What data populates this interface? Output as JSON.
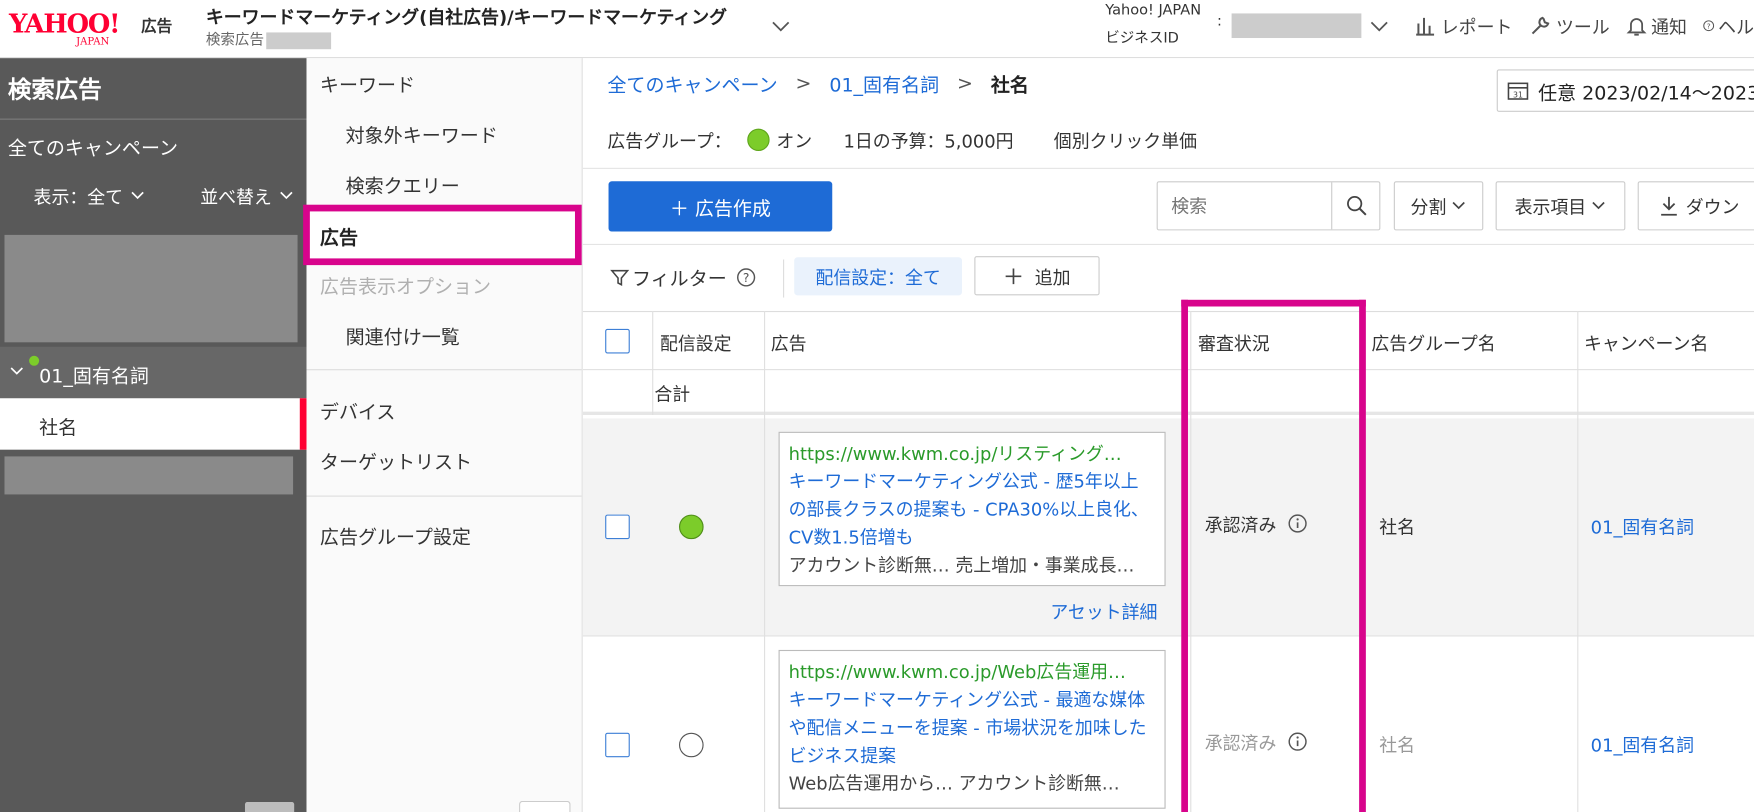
{
  "header": {
    "logo_main": "YAHOO!",
    "logo_sub": "JAPAN",
    "logo_tag": "広告",
    "account_name": "キーワードマーケティング(自社広告)/キーワードマーケティング",
    "account_sub": "検索広告",
    "bizid_line1": "Yahoo! JAPAN",
    "bizid_line2": "ビジネスID",
    "bizid_colon": ":",
    "report": "レポート",
    "tools": "ツール",
    "notify": "通知",
    "help": "ヘル"
  },
  "sidebar": {
    "title": "検索広告",
    "all_campaigns": "全てのキャンペーン",
    "display": "表示：全て",
    "sort": "並べ替え",
    "campaign": "01_固有名詞",
    "adgroup": "社名"
  },
  "menu": {
    "keyword": "キーワード",
    "negative": "対象外キーワード",
    "query": "検索クエリー",
    "ads": "広告",
    "ad_ext": "広告表示オプション",
    "related": "関連付け一覧",
    "device": "デバイス",
    "target": "ターゲットリスト",
    "adgroup_settings": "広告グループ設定"
  },
  "main": {
    "breadcrumb": {
      "all": "全てのキャンペーン",
      "sep1": ">",
      "campaign": "01_固有名詞",
      "sep2": ">",
      "current": "社名"
    },
    "date": "任意 2023/02/14～2023",
    "adgroup_label": "広告グループ：",
    "adgroup_status": "オン",
    "budget": "1日の予算：5,000円",
    "cpc": "個別クリック単価",
    "create_btn": "＋ 広告作成",
    "search_placeholder": "検索",
    "split": "分割",
    "columns": "表示項目",
    "download": "ダウン",
    "filter": "フィルター",
    "filter_chip": "配信設定：全て",
    "add": "追加",
    "table": {
      "headers": {
        "delivery": "配信設定",
        "ad": "広告",
        "review": "審査状況",
        "adgroup": "広告グループ名",
        "campaign": "キャンペーン名"
      },
      "total": "合計",
      "rows": [
        {
          "url": "https://www.kwm.co.jp/リスティング…",
          "headline": "キーワードマーケティング公式 - 歴5年以上の部長クラスの提案も - CPA30%以上良化、CV数1.5倍増も",
          "desc": "アカウント診断無…  売上増加・事業成長…",
          "asset": "アセット詳細",
          "review": "承認済み",
          "adgroup": "社名",
          "campaign": "01_固有名詞",
          "on": true
        },
        {
          "url": "https://www.kwm.co.jp/Web広告運用…",
          "headline": "キーワードマーケティング公式 - 最適な媒体や配信メニューを提案 - 市場状況を加味したビジネス提案",
          "desc": "Web広告運用から…  アカウント診断無…",
          "review": "承認済み",
          "adgroup": "社名",
          "campaign": "01_固有名詞",
          "on": false
        }
      ]
    }
  },
  "colors": {
    "brand_red": "#ff0033",
    "accent_blue": "#1e6bd6",
    "highlight": "#d8048c",
    "status_green": "#7ccc2a",
    "sidebar_bg": "#595959"
  }
}
